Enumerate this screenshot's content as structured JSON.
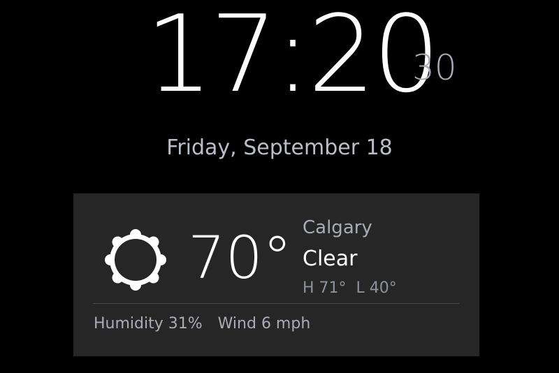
{
  "clock": {
    "time": "17:20",
    "seconds": "30",
    "date": "Friday, September 18"
  },
  "weather": {
    "icon": "sun-icon",
    "temperature": "70°",
    "city": "Calgary",
    "condition": "Clear",
    "high": "H 71°",
    "low": "L 40°",
    "humidity": "Humidity 31%",
    "wind": "Wind 6 mph"
  },
  "colors": {
    "background": "#000000",
    "card": "#262626",
    "primary_text": "#ffffff",
    "secondary_text": "#a7adb8"
  }
}
